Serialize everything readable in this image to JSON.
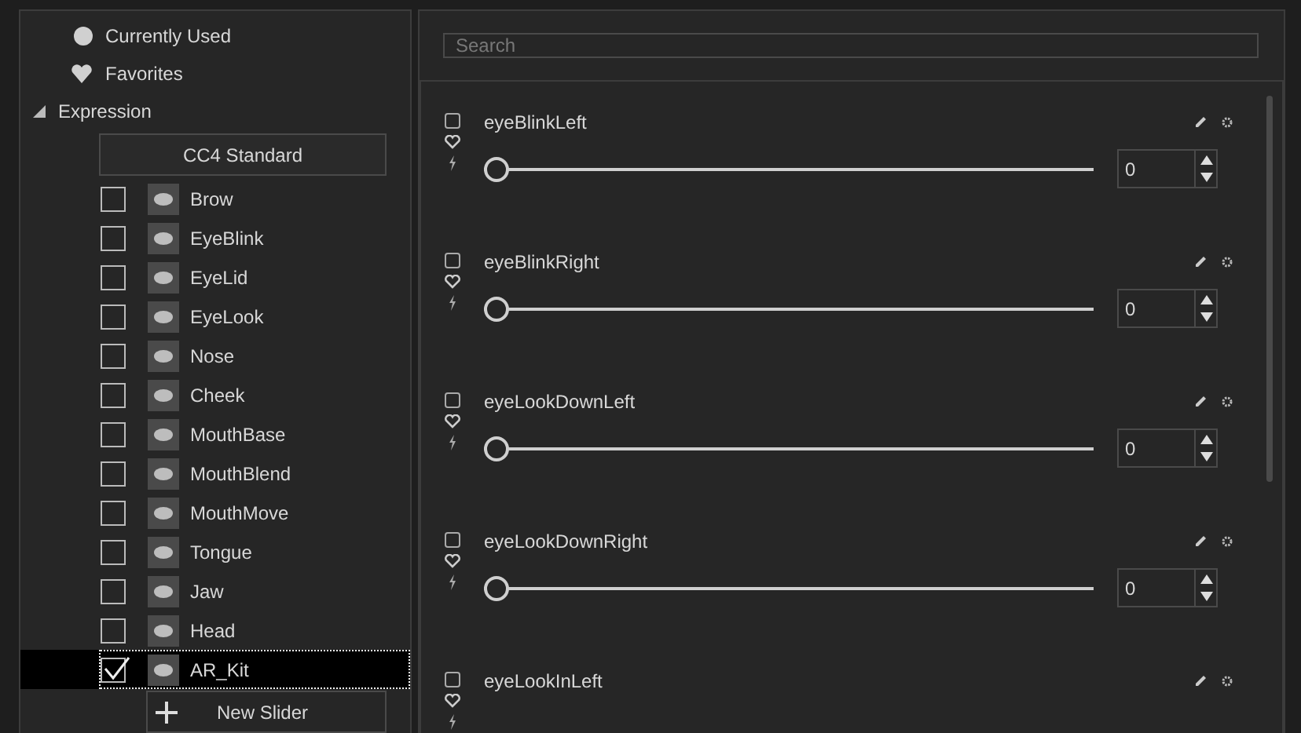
{
  "tree": {
    "quick_items": [
      {
        "kind": "circle",
        "label": "Currently Used"
      },
      {
        "kind": "heart",
        "label": "Favorites"
      }
    ],
    "group": {
      "label": "Expression",
      "expanded": true,
      "preset_button": "CC4 Standard",
      "children": [
        {
          "label": "Brow",
          "checked": false,
          "selected": false
        },
        {
          "label": "EyeBlink",
          "checked": false,
          "selected": false
        },
        {
          "label": "EyeLid",
          "checked": false,
          "selected": false
        },
        {
          "label": "EyeLook",
          "checked": false,
          "selected": false
        },
        {
          "label": "Nose",
          "checked": false,
          "selected": false
        },
        {
          "label": "Cheek",
          "checked": false,
          "selected": false
        },
        {
          "label": "MouthBase",
          "checked": false,
          "selected": false
        },
        {
          "label": "MouthBlend",
          "checked": false,
          "selected": false
        },
        {
          "label": "MouthMove",
          "checked": false,
          "selected": false
        },
        {
          "label": "Tongue",
          "checked": false,
          "selected": false
        },
        {
          "label": "Jaw",
          "checked": false,
          "selected": false
        },
        {
          "label": "Head",
          "checked": false,
          "selected": false
        },
        {
          "label": "AR_Kit",
          "checked": true,
          "selected": true
        }
      ],
      "new_button": "New Slider"
    }
  },
  "search": {
    "placeholder": "Search"
  },
  "sliders": [
    {
      "name": "eyeBlinkLeft",
      "checked": false,
      "level": 0,
      "value": "0"
    },
    {
      "name": "eyeBlinkRight",
      "checked": false,
      "level": 0,
      "value": "0"
    },
    {
      "name": "eyeLookDownLeft",
      "checked": false,
      "level": 0,
      "value": "0"
    },
    {
      "name": "eyeLookDownRight",
      "checked": false,
      "level": 0,
      "value": "0"
    },
    {
      "name": "eyeLookInLeft",
      "checked": false
    }
  ]
}
